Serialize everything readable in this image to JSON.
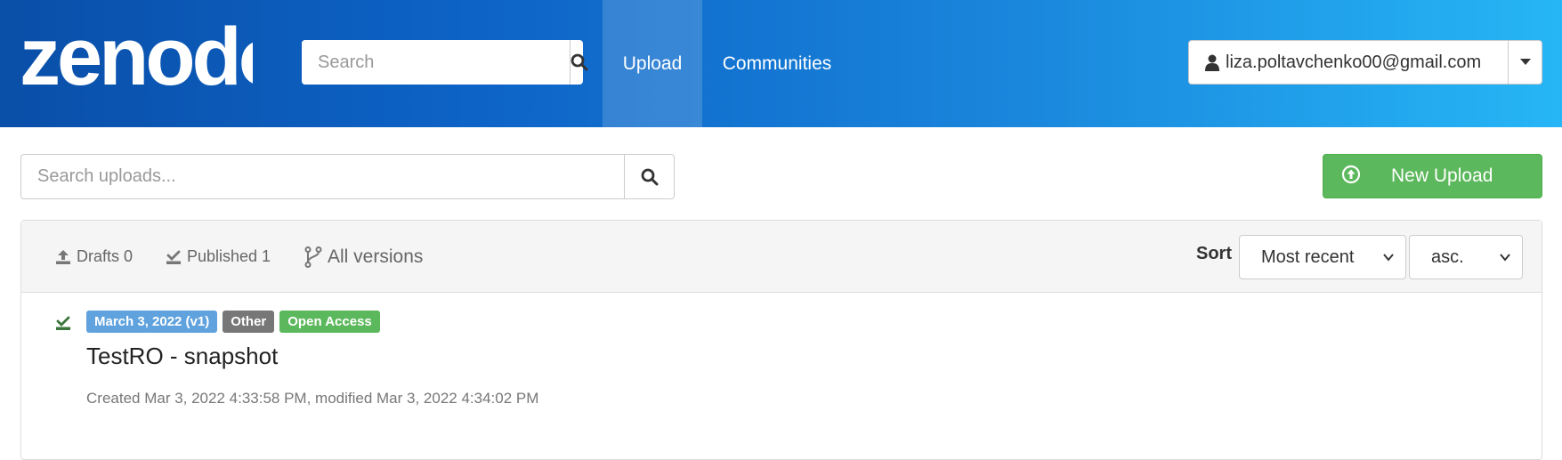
{
  "header": {
    "logo_text": "zenodo",
    "search_placeholder": "Search",
    "nav": {
      "upload": "Upload",
      "communities": "Communities"
    },
    "user_email": "liza.poltavchenko00@gmail.com"
  },
  "toolbar": {
    "search_placeholder": "Search uploads...",
    "new_upload_label": "New Upload"
  },
  "filters": {
    "drafts_label": "Drafts 0",
    "published_label": "Published 1",
    "versions_label": "All versions",
    "sort_label": "Sort",
    "sort_value": "Most recent",
    "order_value": "asc."
  },
  "records": [
    {
      "date_badge": "March 3, 2022 (v1)",
      "type_badge": "Other",
      "access_badge": "Open Access",
      "title": "TestRO - snapshot",
      "meta": "Created Mar 3, 2022 4:33:58 PM, modified Mar 3, 2022 4:34:02 PM"
    }
  ],
  "colors": {
    "header_gradient_start": "#0a4fa8",
    "header_gradient_end": "#26b6f5",
    "success_green": "#5cb85c",
    "date_badge_blue": "#5fa2dd",
    "type_badge_gray": "#777777"
  }
}
